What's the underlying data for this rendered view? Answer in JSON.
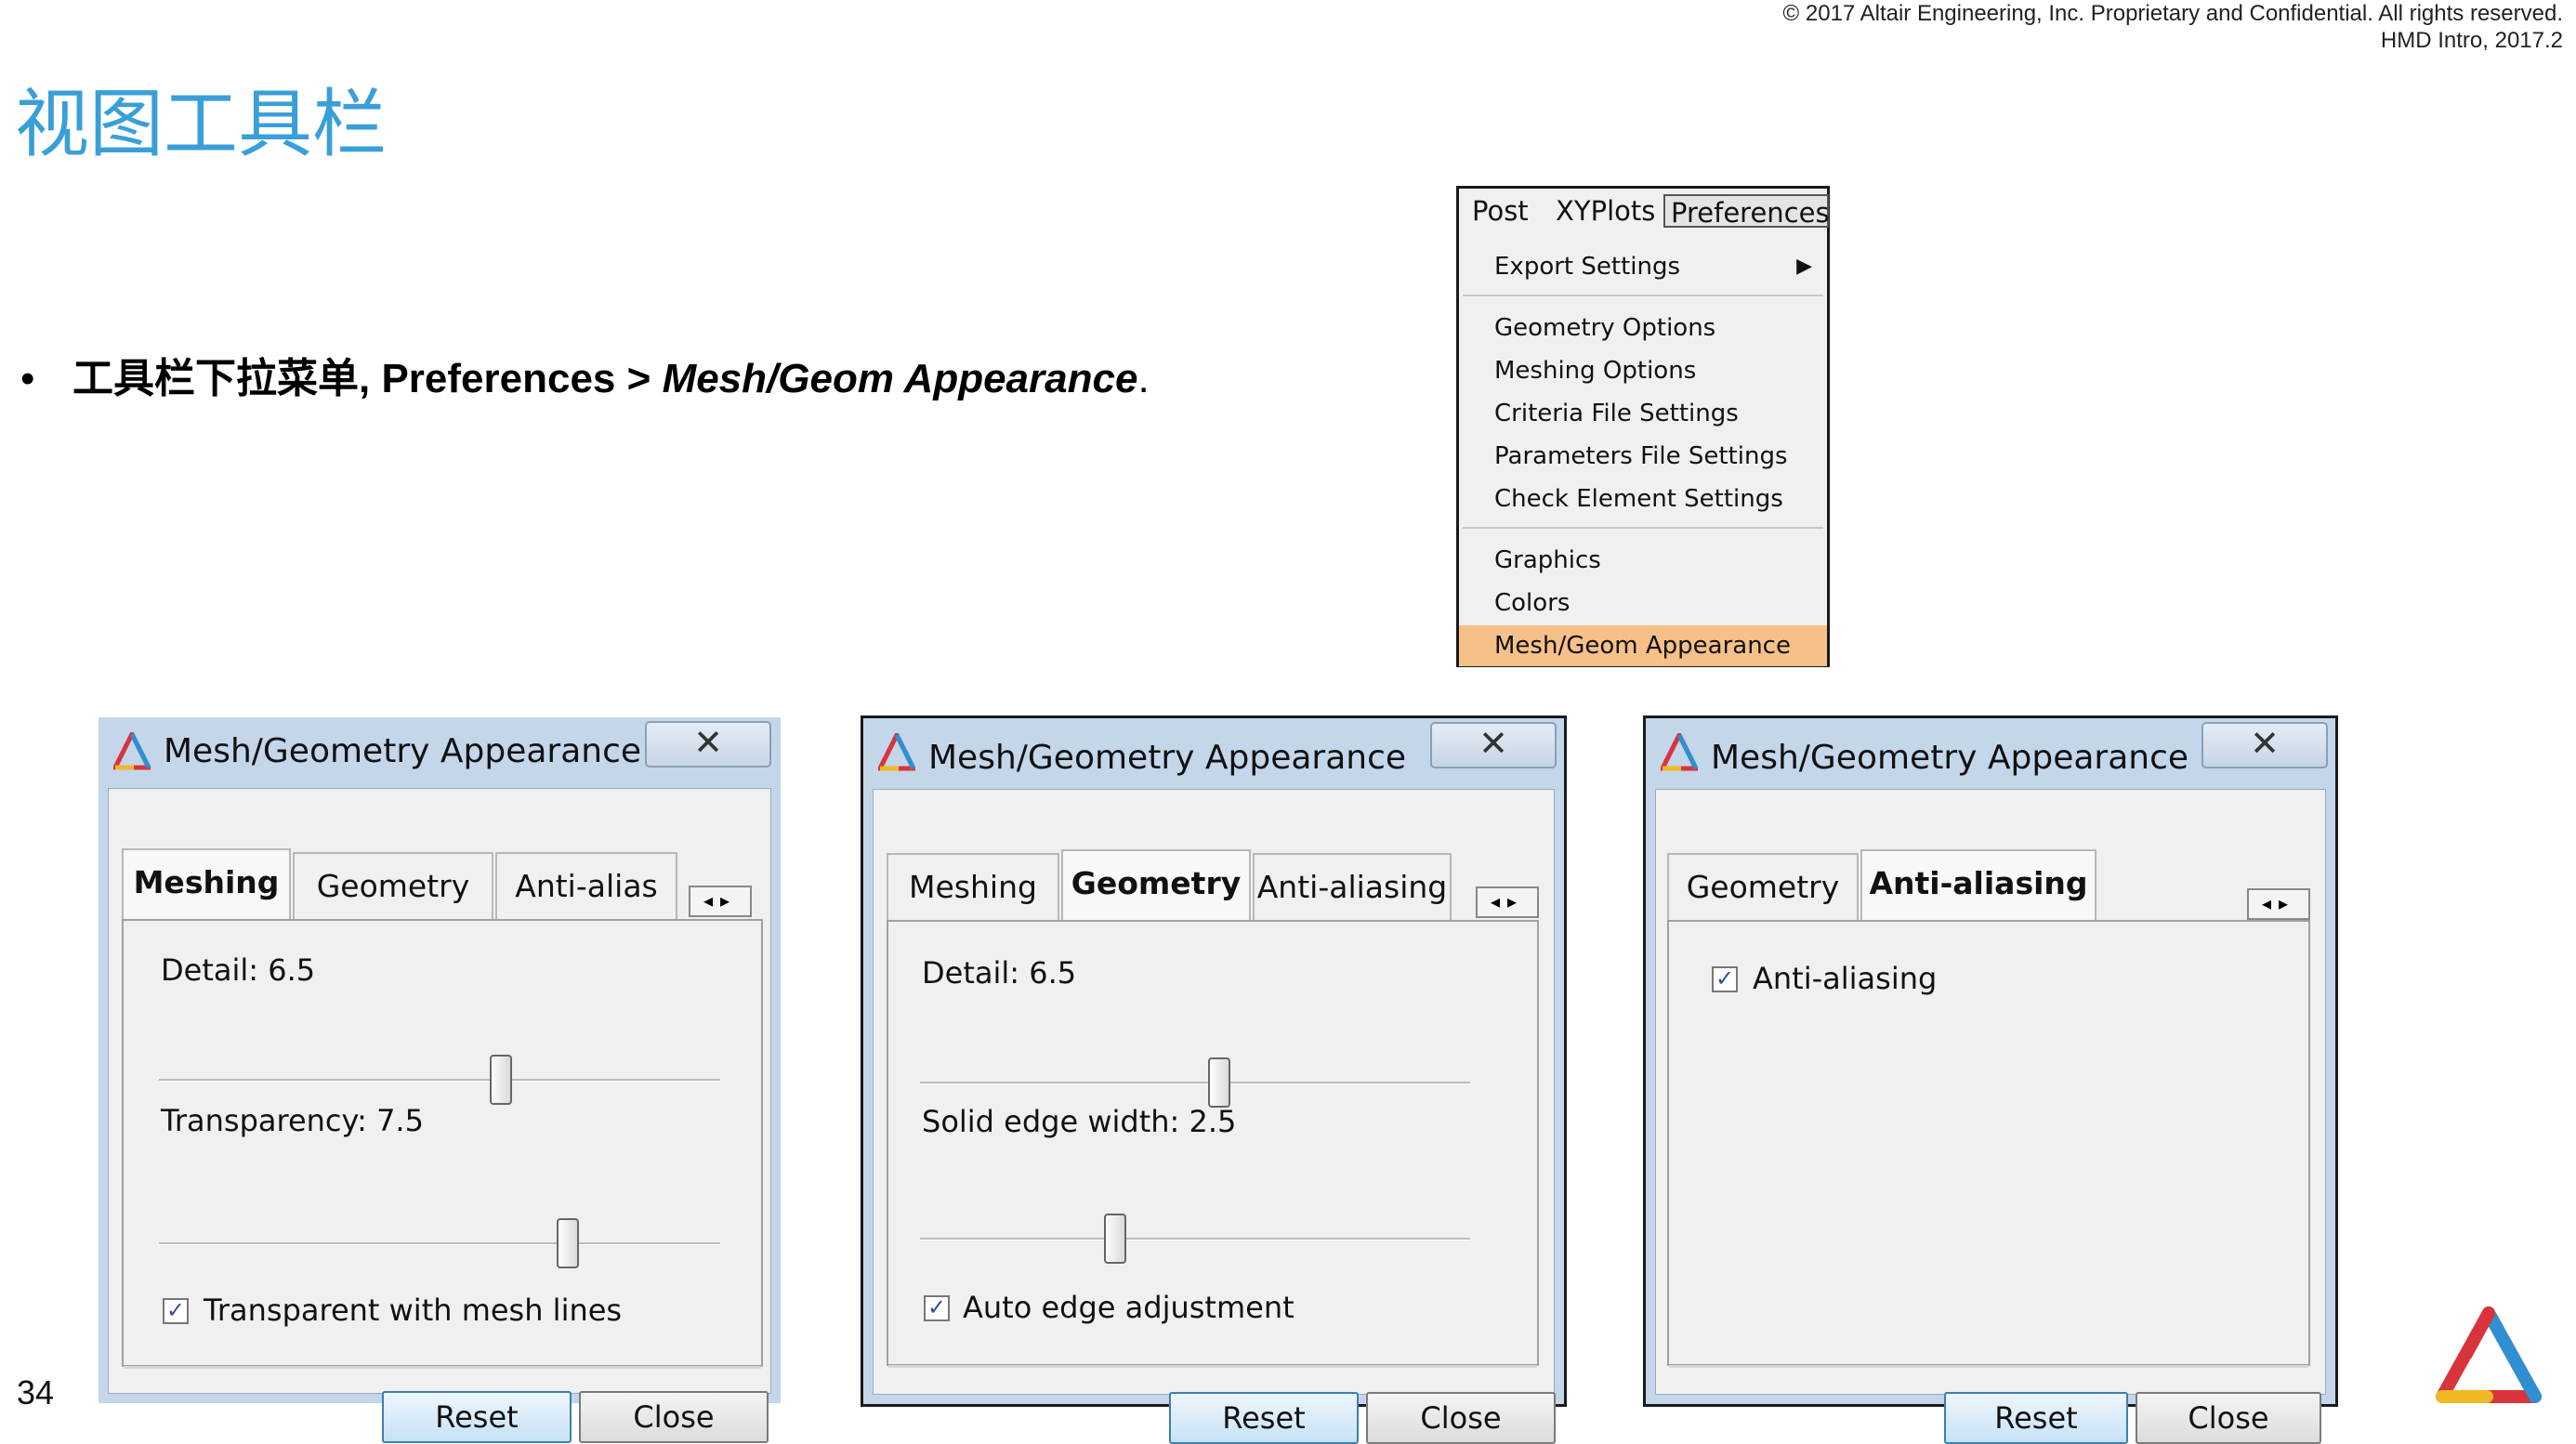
{
  "header": {
    "copyright": "© 2017 Altair Engineering, Inc. Proprietary and Confidential. All rights reserved.",
    "course": "HMD Intro, 2017.2"
  },
  "slide": {
    "title": "视图工具栏",
    "bullet_symbol": "•",
    "bullet_prefix": "工具栏下拉菜单, ",
    "bullet_menu": "Preferences",
    "bullet_sep": " > ",
    "bullet_item": "Mesh/Geom Appearance",
    "bullet_end": ".",
    "page_number": "34"
  },
  "menu": {
    "bar": [
      "Post",
      "XYPlots",
      "Preferences"
    ],
    "items": {
      "export_settings": "Export Settings",
      "geometry_options": "Geometry Options",
      "meshing_options": "Meshing Options",
      "criteria_file_settings": "Criteria File Settings",
      "parameters_file_settings": "Parameters File Settings",
      "check_element_settings": "Check Element Settings",
      "graphics": "Graphics",
      "colors": "Colors",
      "mesh_geom_appearance": "Mesh/Geom Appearance"
    },
    "highlight_color": "#f6c089"
  },
  "dialogs": [
    {
      "title": "Mesh/Geometry Appearance",
      "close_glyph": "✕",
      "tabs": [
        "Meshing",
        "Geometry",
        "Anti-alias"
      ],
      "tab_scroll": "◂▸",
      "detail_label": "Detail: 6.5",
      "transparency_label": "Transparency: 7.5",
      "checkbox_label": "Transparent with mesh lines",
      "checked": true,
      "reset": "Reset",
      "close": "Close"
    },
    {
      "title": "Mesh/Geometry Appearance",
      "close_glyph": "✕",
      "tabs": [
        "Meshing",
        "Geometry",
        "Anti-aliasing"
      ],
      "tab_scroll": "◂▸",
      "detail_label": "Detail: 6.5",
      "solid_edge_label": "Solid edge width: 2.5",
      "checkbox_label": "Auto edge adjustment",
      "checked": true,
      "reset": "Reset",
      "close": "Close"
    },
    {
      "title": "Mesh/Geometry Appearance",
      "close_glyph": "✕",
      "tabs": [
        "Geometry",
        "Anti-aliasing"
      ],
      "tab_scroll": "◂▸",
      "checkbox_label": "Anti-aliasing",
      "checked": true,
      "reset": "Reset",
      "close": "Close"
    }
  ],
  "check_glyph": "✓",
  "submenu_arrow": "▶",
  "colors": {
    "title_blue": "#3a9fd8",
    "window_frame": "#c3d6ea",
    "altair_red": "#d9343b",
    "altair_blue": "#2f8fd1",
    "altair_yellow": "#f2b824"
  }
}
